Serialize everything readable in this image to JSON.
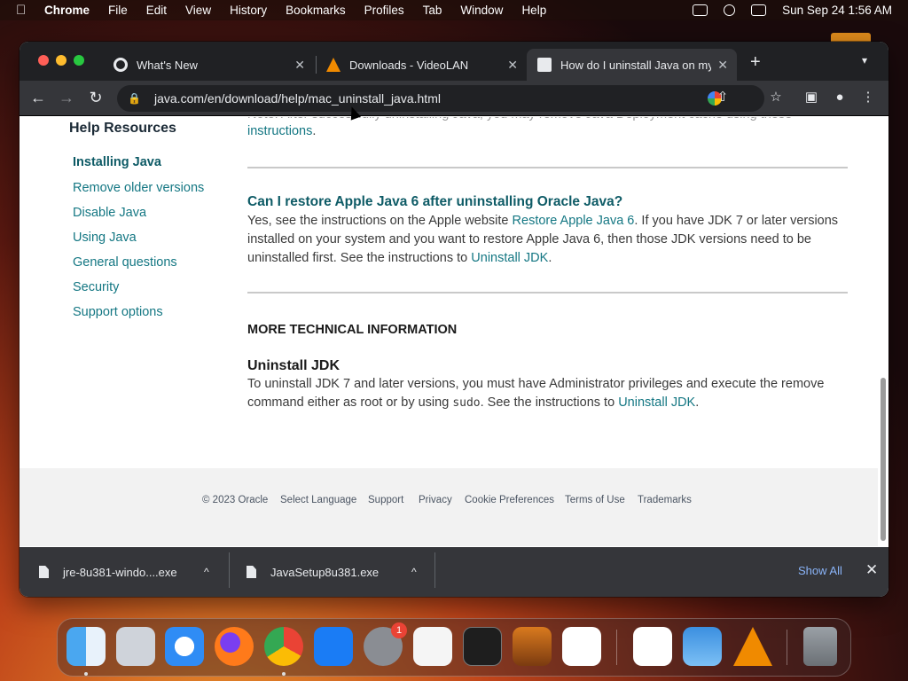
{
  "menubar": {
    "app": "Chrome",
    "items": [
      "File",
      "Edit",
      "View",
      "History",
      "Bookmarks",
      "Profiles",
      "Tab",
      "Window",
      "Help"
    ],
    "datetime": "Sun Sep 24  1:56 AM"
  },
  "tabs": [
    {
      "title": "What's New"
    },
    {
      "title": "Downloads - VideoLAN"
    },
    {
      "title": "How do I uninstall Java on my M"
    }
  ],
  "toolbar": {
    "url": "java.com/en/download/help/mac_uninstall_java.html"
  },
  "sidebar": {
    "title": "Help Resources",
    "items": [
      {
        "label": "Installing Java"
      },
      {
        "label": "Remove older versions"
      },
      {
        "label": "Disable Java"
      },
      {
        "label": "Using Java"
      },
      {
        "label": "General questions"
      },
      {
        "label": "Security"
      },
      {
        "label": "Support options"
      }
    ]
  },
  "main": {
    "top_partial": "Note: After successfully uninstalling Java, you may remove Java Deployment cache using these",
    "top_link": "instructions",
    "q2_title": "Can I restore Apple Java 6 after uninstalling Oracle Java?",
    "q2_text1": "Yes, see the instructions on the Apple website ",
    "q2_link1": "Restore Apple Java 6",
    "q2_text2": ". If you have JDK 7 or later versions installed on your system and you want to restore Apple Java 6, then those JDK versions need to be uninstalled first. See the instructions to ",
    "q2_link2": "Uninstall JDK",
    "q2_text3": ".",
    "more_heading": "MORE TECHNICAL INFORMATION",
    "jdk_heading": "Uninstall JDK",
    "jdk_text1": "To uninstall JDK 7 and later versions, you must have Administrator privileges and execute the remove command either as root or by using ",
    "jdk_code": "sudo",
    "jdk_text2": ". See the instructions to ",
    "jdk_link": "Uninstall JDK",
    "jdk_text3": "."
  },
  "footer": {
    "copyright": "© 2023 Oracle",
    "links": [
      "Select Language",
      "Support",
      "Privacy",
      "Cookie Preferences",
      "Terms of Use",
      "Trademarks"
    ]
  },
  "downloads": {
    "items": [
      {
        "name": "jre-8u381-windo....exe"
      },
      {
        "name": "JavaSetup8u381.exe"
      }
    ],
    "show_all": "Show All"
  },
  "dock": {
    "badge": "1",
    "apps": [
      "finder-icon",
      "launchpad-icon",
      "safari-icon",
      "firefox-icon",
      "chrome-icon",
      "app-store-icon",
      "system-preferences-icon",
      "textedit-icon",
      "terminal-icon",
      "instruments-icon",
      "vscode-icon",
      "visual-studio-icon",
      "weather-icon",
      "vlc-icon",
      "trash-icon"
    ]
  },
  "colors": {
    "link": "#147783",
    "link_dark": "#0e5b66"
  }
}
